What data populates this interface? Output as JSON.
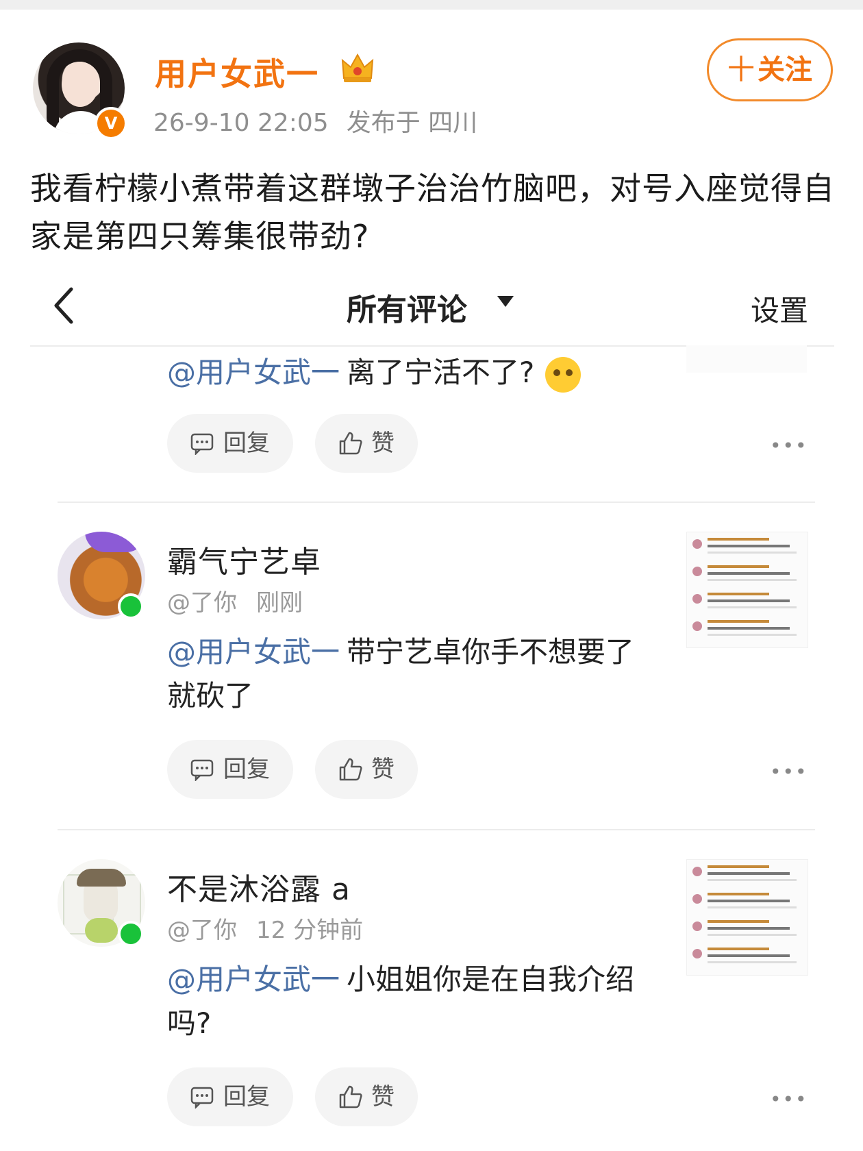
{
  "post": {
    "author": "用户女武一",
    "verified_badge": "V",
    "time": "26-9-10 22:05",
    "location": "发布于 四川",
    "follow_label": "关注",
    "follow_plus": "十",
    "text": "我看柠檬小煮带着这群墩子治治竹脑吧，对号入座觉得自家是第四只筹集很带劲?"
  },
  "nav": {
    "back_icon": "chevron-left-icon",
    "title": "所有评论",
    "settings": "设置"
  },
  "comments": [
    {
      "mention": "@用户女武一",
      "text": "离了宁活不了?",
      "emoji": "crying-emoji",
      "reply_label": "回复",
      "like_label": "赞",
      "more": "•••"
    },
    {
      "name": "霸气宁艺卓",
      "via": "@了你",
      "time": "刚刚",
      "mention": "@用户女武一",
      "text": "带宁艺卓你手不想要了就砍了",
      "reply_label": "回复",
      "like_label": "赞",
      "more": "•••"
    },
    {
      "name": "不是沐浴露 a",
      "via": "@了你",
      "time": "12 分钟前",
      "mention": "@用户女武一",
      "text": "小姐姐你是在自我介绍吗?",
      "reply_label": "回复",
      "like_label": "赞",
      "more": "•••"
    }
  ],
  "colors": {
    "accent_orange": "#f27311",
    "mention_blue": "#4a6fa5",
    "online_green": "#19c23a"
  }
}
